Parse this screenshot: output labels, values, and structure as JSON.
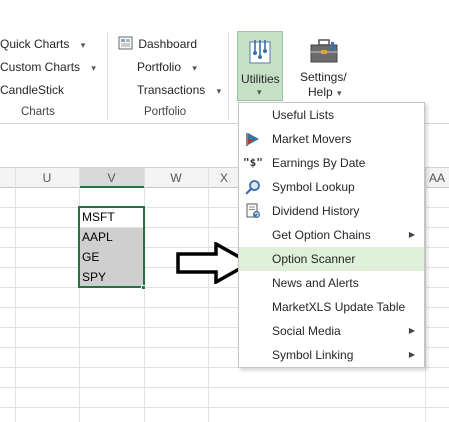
{
  "ribbon": {
    "charts_group": {
      "quick_charts": "Quick Charts",
      "custom_charts": "Custom Charts",
      "candlestick": "CandleStick",
      "label": "Charts"
    },
    "portfolio_group": {
      "dashboard": "Dashboard",
      "portfolio": "Portfolio",
      "transactions": "Transactions",
      "label": "Portfolio"
    },
    "utilities": {
      "label": "Utilities"
    },
    "settings": {
      "label_line1": "Settings/",
      "label_line2": "Help"
    }
  },
  "sheet": {
    "columns": [
      "U",
      "V",
      "W",
      "X",
      "AA"
    ],
    "cells": [
      "MSFT",
      "AAPL",
      "GE",
      "SPY"
    ]
  },
  "dropdown": {
    "items": [
      {
        "label": "Useful Lists",
        "icon": "none",
        "submenu": false
      },
      {
        "label": "Market Movers",
        "icon": "market-movers-icon",
        "submenu": false
      },
      {
        "label": "Earnings By Date",
        "icon": "dollar-quote-icon",
        "submenu": false
      },
      {
        "label": "Symbol Lookup",
        "icon": "search-icon",
        "submenu": false
      },
      {
        "label": "Dividend History",
        "icon": "document-refresh-icon",
        "submenu": false
      },
      {
        "label": "Get Option Chains",
        "icon": "none",
        "submenu": true
      },
      {
        "label": "Option Scanner",
        "icon": "none",
        "submenu": false,
        "highlighted": true
      },
      {
        "label": "News and Alerts",
        "icon": "none",
        "submenu": false
      },
      {
        "label": "MarketXLS Update Table",
        "icon": "none",
        "submenu": false
      },
      {
        "label": "Social Media",
        "icon": "none",
        "submenu": true
      },
      {
        "label": "Symbol Linking",
        "icon": "none",
        "submenu": true
      }
    ]
  },
  "glyphs": {
    "caret": "▾",
    "submenu_arrow": "▶",
    "dollar": "\"$\""
  },
  "colors": {
    "utilities_active": "#c6e0c6",
    "menu_highlight": "#dff0d8",
    "selection_border": "#217346"
  }
}
